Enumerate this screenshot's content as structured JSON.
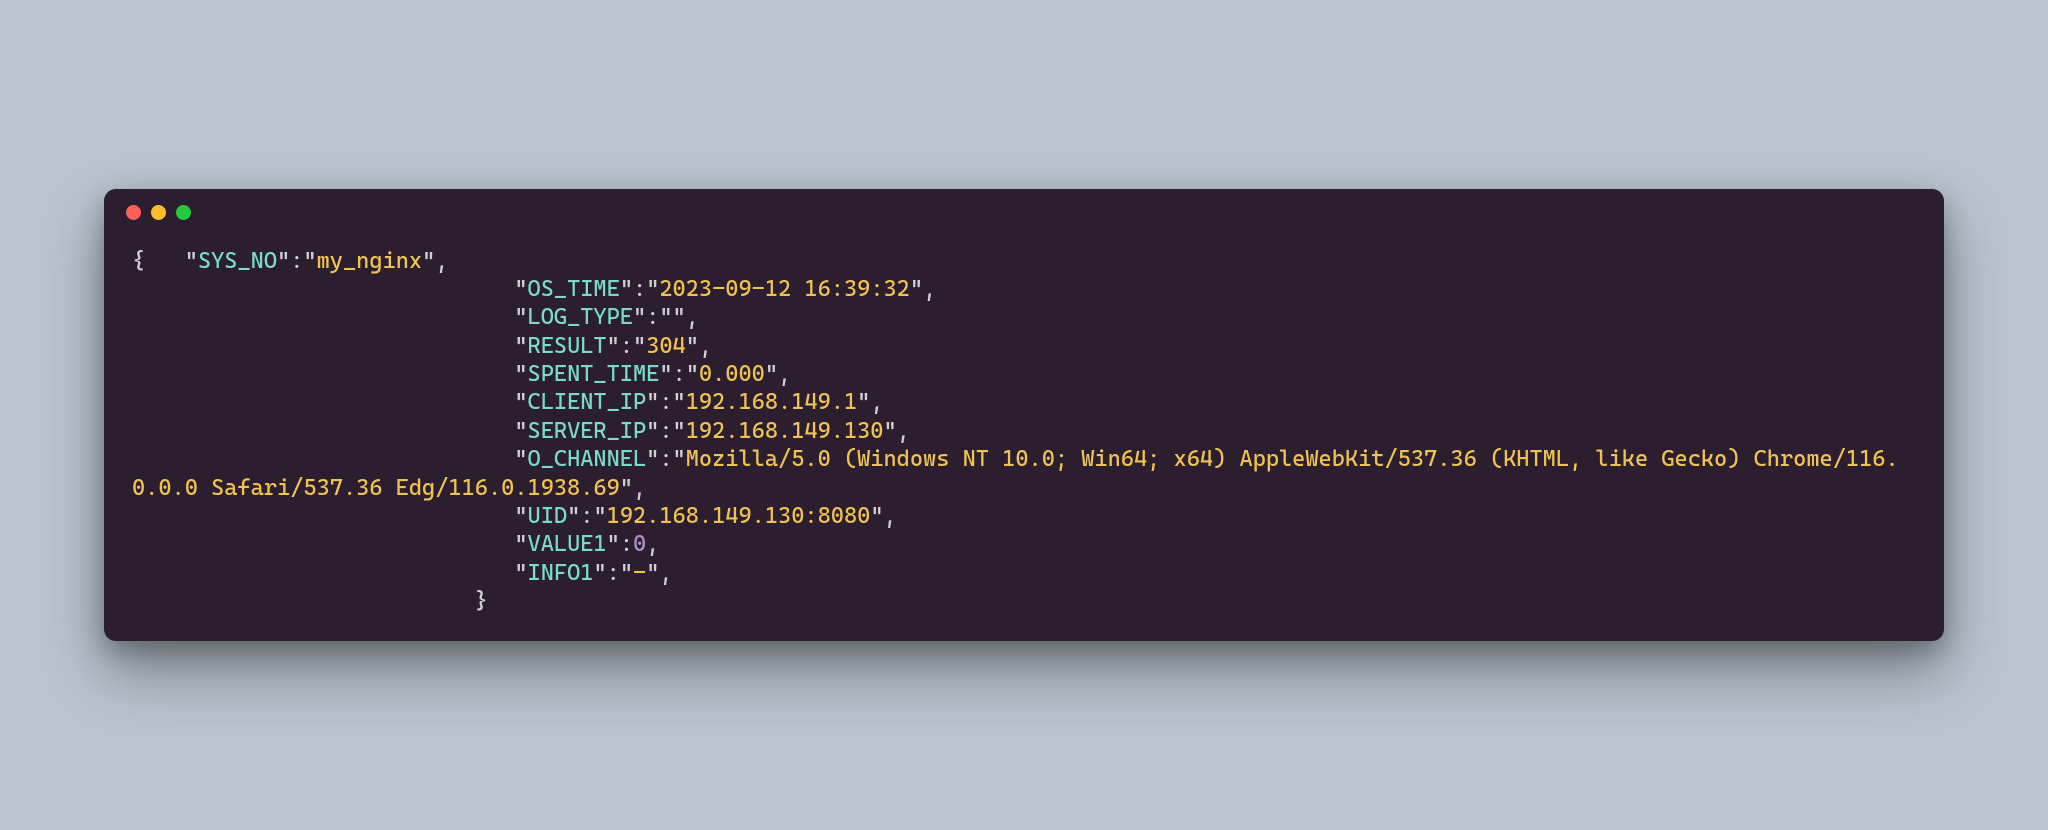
{
  "colors": {
    "background": "#b8c4ce",
    "window": "#2b1e2e",
    "punctuation": "#cfd0d2",
    "key": "#7bdbc5",
    "string": "#f0c254",
    "number": "#b48cc9"
  },
  "traffic_lights": {
    "red": "#ff5f56",
    "yellow": "#ffbd2e",
    "green": "#27c93f"
  },
  "log": {
    "open_brace": "{",
    "close_brace": "}",
    "colon": ":",
    "comma": ",",
    "indent0": "   ",
    "indent1": "                             ",
    "indent_close": "                          ",
    "quote": "\"",
    "keys": {
      "sys_no": "SYS_NO",
      "os_time": "OS_TIME",
      "log_type": "LOG_TYPE",
      "result": "RESULT",
      "spent_time": "SPENT_TIME",
      "client_ip": "CLIENT_IP",
      "server_ip": "SERVER_IP",
      "o_channel": "O_CHANNEL",
      "uid": "UID",
      "value1": "VALUE1",
      "info1": "INFO1"
    },
    "values": {
      "sys_no": "my_nginx",
      "os_time": "2023-09-12 16:39:32",
      "log_type": "",
      "result": "304",
      "spent_time": "0.000",
      "client_ip": "192.168.149.1",
      "server_ip": "192.168.149.130",
      "o_channel": "Mozilla/5.0 (Windows NT 10.0; Win64; x64) AppleWebKit/537.36 (KHTML, like Gecko) Chrome/116.0.0.0 Safari/537.36 Edg/116.0.1938.69",
      "uid": "192.168.149.130:8080",
      "value1": "0",
      "info1": "-"
    }
  }
}
